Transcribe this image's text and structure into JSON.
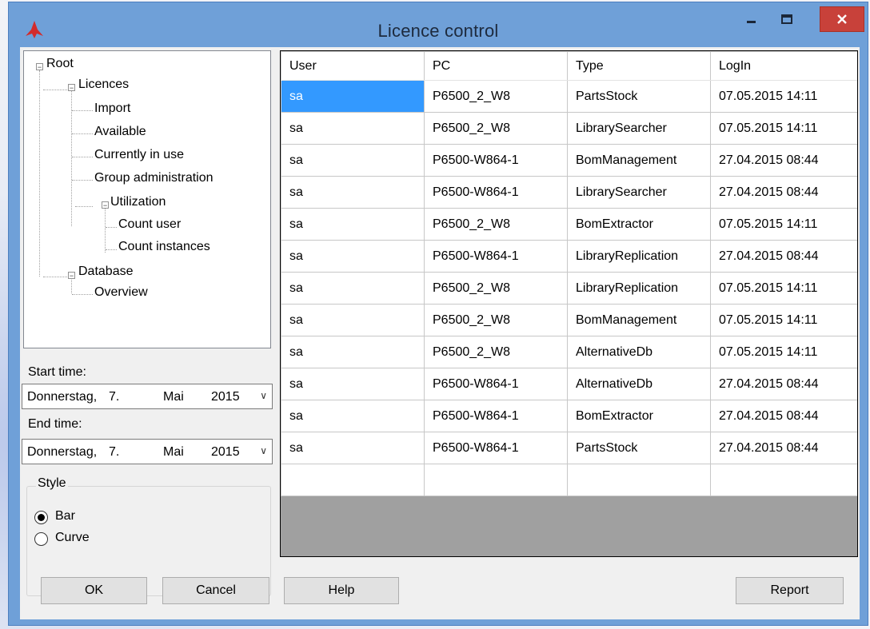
{
  "window": {
    "title": "Licence control",
    "accent": "#6fa0d8",
    "close_color": "#c8413a"
  },
  "tree": {
    "root": "Root",
    "licences": "Licences",
    "import": "Import",
    "available": "Available",
    "in_use": "Currently in use",
    "group_admin": "Group administration",
    "utilization": "Utilization",
    "count_user": "Count user",
    "count_instances": "Count instances",
    "database": "Database",
    "overview": "Overview"
  },
  "start_time": {
    "label": "Start time:",
    "weekday": "Donnerstag,",
    "day": "7.",
    "month": "Mai",
    "year": "2015"
  },
  "end_time": {
    "label": "End time:",
    "weekday": "Donnerstag,",
    "day": "7.",
    "month": "Mai",
    "year": "2015"
  },
  "style": {
    "title": "Style",
    "bar": "Bar",
    "curve": "Curve",
    "selected": "Bar"
  },
  "table": {
    "headers": [
      "User",
      "PC",
      "Type",
      "LogIn"
    ],
    "rows": [
      [
        "sa",
        "P6500_2_W8",
        "PartsStock",
        "07.05.2015 14:11"
      ],
      [
        "sa",
        "P6500_2_W8",
        "LibrarySearcher",
        "07.05.2015 14:11"
      ],
      [
        "sa",
        "P6500-W864-1",
        "BomManagement",
        "27.04.2015 08:44"
      ],
      [
        "sa",
        "P6500-W864-1",
        "LibrarySearcher",
        "27.04.2015 08:44"
      ],
      [
        "sa",
        "P6500_2_W8",
        "BomExtractor",
        "07.05.2015 14:11"
      ],
      [
        "sa",
        "P6500-W864-1",
        "LibraryReplication",
        "27.04.2015 08:44"
      ],
      [
        "sa",
        "P6500_2_W8",
        "LibraryReplication",
        "07.05.2015 14:11"
      ],
      [
        "sa",
        "P6500_2_W8",
        "BomManagement",
        "07.05.2015 14:11"
      ],
      [
        "sa",
        "P6500_2_W8",
        "AlternativeDb",
        "07.05.2015 14:11"
      ],
      [
        "sa",
        "P6500-W864-1",
        "AlternativeDb",
        "27.04.2015 08:44"
      ],
      [
        "sa",
        "P6500-W864-1",
        "BomExtractor",
        "27.04.2015 08:44"
      ],
      [
        "sa",
        "P6500-W864-1",
        "PartsStock",
        "27.04.2015 08:44"
      ]
    ]
  },
  "buttons": {
    "ok": "OK",
    "cancel": "Cancel",
    "help": "Help",
    "report": "Report"
  }
}
